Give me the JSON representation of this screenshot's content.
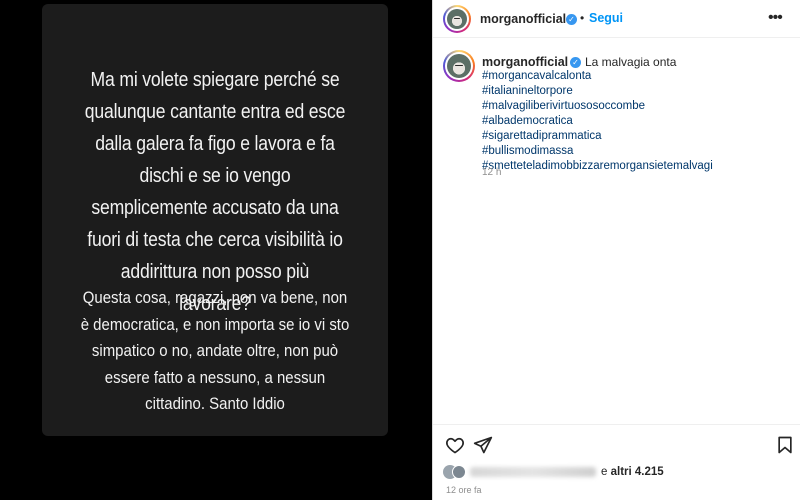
{
  "story": {
    "main_text": "Ma mi volete spiegare perché se qualunque cantante entra ed esce dalla galera fa figo e lavora e fa dischi e se io vengo semplicemente accusato da una fuori di testa che cerca visibilità io addirittura non posso più lavorare?",
    "sub_text": "Questa cosa, ragazzi, non va bene, non è democratica, e non importa se io vi sto simpatico o no, andate oltre, non può essere fatto a nessuno, a nessun cittadino. Santo Iddio"
  },
  "header": {
    "username": "morganofficial",
    "separator": "•",
    "follow_label": "Segui",
    "more_icon": "more-horizontal-icon"
  },
  "caption": {
    "username": "morganofficial",
    "text": "La malvagia onta",
    "hashtags": [
      "#morgancavalcalonta",
      "#italianineltorpore",
      "#malvagiliberivirtuososoccombe",
      "#albademocratica",
      "#sigarettadiprammatica",
      "#bullismodimassa",
      "#smetteteladimobbizzaremorgansietemalvagi"
    ],
    "time_ago": "12 h"
  },
  "actions": {
    "like_icon": "heart-icon",
    "share_icon": "send-icon",
    "save_icon": "bookmark-icon"
  },
  "likes": {
    "prefix": "e",
    "others_label": "altri 4.215"
  },
  "post_time": "12 ore fa",
  "colors": {
    "link": "#00376b",
    "follow": "#0095f6",
    "verified": "#3797f0",
    "muted": "#8e8e8e"
  }
}
